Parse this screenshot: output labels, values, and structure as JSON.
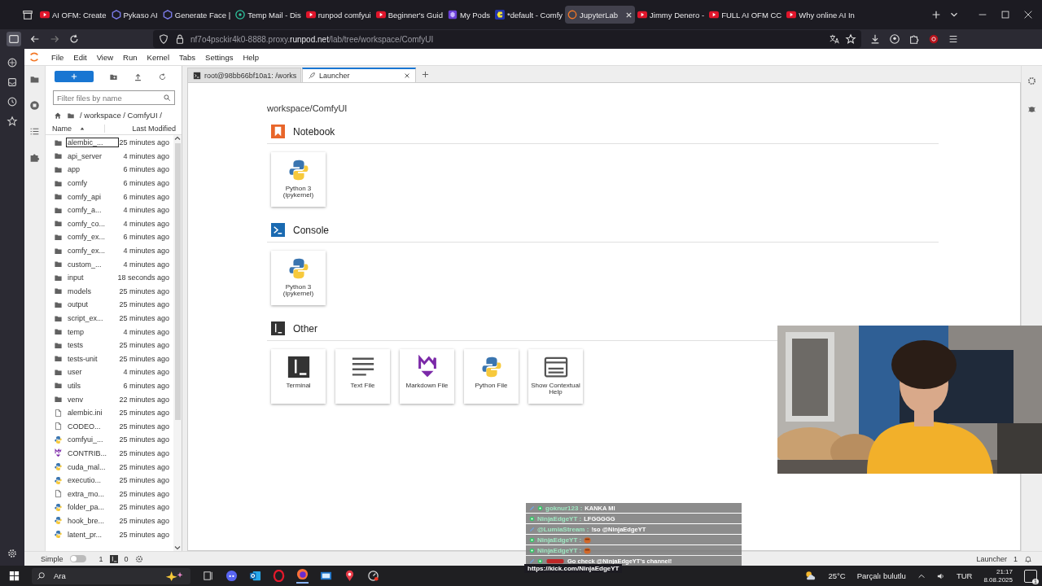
{
  "browser": {
    "tabs": [
      {
        "title": "AI OFM: Create",
        "kind": "youtube",
        "selected": false
      },
      {
        "title": "Pykaso AI",
        "kind": "hex",
        "selected": false
      },
      {
        "title": "Generate Face |",
        "kind": "hex",
        "selected": false
      },
      {
        "title": "Temp Mail - Dis",
        "kind": "mail",
        "selected": false
      },
      {
        "title": "runpod comfyui",
        "kind": "youtube",
        "selected": false
      },
      {
        "title": "Beginner's Guid",
        "kind": "youtube",
        "selected": false
      },
      {
        "title": "My Pods",
        "kind": "pods",
        "selected": false
      },
      {
        "title": "*default - Comfy",
        "kind": "comfy",
        "selected": false
      },
      {
        "title": "JupyterLab",
        "kind": "jupyter",
        "selected": true
      },
      {
        "title": "Jimmy Denero -",
        "kind": "youtube",
        "selected": false
      },
      {
        "title": "FULL AI OFM CC",
        "kind": "youtube",
        "selected": false
      },
      {
        "title": "Why online AI In",
        "kind": "youtube",
        "selected": false
      }
    ],
    "url": {
      "host": "nf7o4psckir4k0-8888.proxy.",
      "domain": "runpod.net",
      "path": "/lab/tree/workspace/ComfyUI"
    }
  },
  "menu": [
    "File",
    "Edit",
    "View",
    "Run",
    "Kernel",
    "Tabs",
    "Settings",
    "Help"
  ],
  "file_browser": {
    "filter": {
      "placeholder": "Filter files by name"
    },
    "breadcrumb": "/ workspace / ComfyUI /",
    "columns": [
      "Name",
      "Last Modified"
    ],
    "rows": [
      {
        "name": "alembic_...",
        "modified": "25 minutes ago",
        "kind": "folder",
        "selected": true
      },
      {
        "name": "api_server",
        "modified": "4 minutes ago",
        "kind": "folder",
        "selected": false
      },
      {
        "name": "app",
        "modified": "6 minutes ago",
        "kind": "folder",
        "selected": false
      },
      {
        "name": "comfy",
        "modified": "6 minutes ago",
        "kind": "folder",
        "selected": false
      },
      {
        "name": "comfy_api",
        "modified": "6 minutes ago",
        "kind": "folder",
        "selected": false
      },
      {
        "name": "comfy_a...",
        "modified": "4 minutes ago",
        "kind": "folder",
        "selected": false
      },
      {
        "name": "comfy_co...",
        "modified": "4 minutes ago",
        "kind": "folder",
        "selected": false
      },
      {
        "name": "comfy_ex...",
        "modified": "6 minutes ago",
        "kind": "folder",
        "selected": false
      },
      {
        "name": "comfy_ex...",
        "modified": "4 minutes ago",
        "kind": "folder",
        "selected": false
      },
      {
        "name": "custom_...",
        "modified": "4 minutes ago",
        "kind": "folder",
        "selected": false
      },
      {
        "name": "input",
        "modified": "18 seconds ago",
        "kind": "folder",
        "selected": false
      },
      {
        "name": "models",
        "modified": "25 minutes ago",
        "kind": "folder",
        "selected": false
      },
      {
        "name": "output",
        "modified": "25 minutes ago",
        "kind": "folder",
        "selected": false
      },
      {
        "name": "script_ex...",
        "modified": "25 minutes ago",
        "kind": "folder",
        "selected": false
      },
      {
        "name": "temp",
        "modified": "4 minutes ago",
        "kind": "folder",
        "selected": false
      },
      {
        "name": "tests",
        "modified": "25 minutes ago",
        "kind": "folder",
        "selected": false
      },
      {
        "name": "tests-unit",
        "modified": "25 minutes ago",
        "kind": "folder",
        "selected": false
      },
      {
        "name": "user",
        "modified": "4 minutes ago",
        "kind": "folder",
        "selected": false
      },
      {
        "name": "utils",
        "modified": "6 minutes ago",
        "kind": "folder",
        "selected": false
      },
      {
        "name": "venv",
        "modified": "22 minutes ago",
        "kind": "folder",
        "selected": false
      },
      {
        "name": "alembic.ini",
        "modified": "25 minutes ago",
        "kind": "file",
        "selected": false
      },
      {
        "name": "CODEO...",
        "modified": "25 minutes ago",
        "kind": "file",
        "selected": false
      },
      {
        "name": "comfyui_...",
        "modified": "25 minutes ago",
        "kind": "python",
        "selected": false
      },
      {
        "name": "CONTRIB...",
        "modified": "25 minutes ago",
        "kind": "markdown",
        "selected": false
      },
      {
        "name": "cuda_mal...",
        "modified": "25 minutes ago",
        "kind": "python",
        "selected": false
      },
      {
        "name": "executio...",
        "modified": "25 minutes ago",
        "kind": "python",
        "selected": false
      },
      {
        "name": "extra_mo...",
        "modified": "25 minutes ago",
        "kind": "file",
        "selected": false
      },
      {
        "name": "folder_pa...",
        "modified": "25 minutes ago",
        "kind": "python",
        "selected": false
      },
      {
        "name": "hook_bre...",
        "modified": "25 minutes ago",
        "kind": "python",
        "selected": false
      },
      {
        "name": "latent_pr...",
        "modified": "25 minutes ago",
        "kind": "python",
        "selected": false
      }
    ]
  },
  "dock_tabs": [
    {
      "title": "root@98bb66bf10a1: /works",
      "kind": "terminal",
      "selected": false
    },
    {
      "title": "Launcher",
      "kind": "launcher",
      "selected": true
    }
  ],
  "launcher": {
    "path": "workspace/ComfyUI",
    "sections": [
      {
        "title": "Notebook",
        "kind": "notebook",
        "cards": [
          {
            "label": "Python 3 (ipykernel)",
            "kind": "python"
          }
        ]
      },
      {
        "title": "Console",
        "kind": "console",
        "cards": [
          {
            "label": "Python 3 (ipykernel)",
            "kind": "python"
          }
        ]
      },
      {
        "title": "Other",
        "kind": "other",
        "cards": [
          {
            "label": "Terminal",
            "kind": "terminal"
          },
          {
            "label": "Text File",
            "kind": "text"
          },
          {
            "label": "Markdown File",
            "kind": "markdown"
          },
          {
            "label": "Python File",
            "kind": "python"
          },
          {
            "label": "Show Contextual Help",
            "kind": "help"
          }
        ]
      }
    ]
  },
  "status_bar": {
    "mode": "Simple",
    "simple_on": false,
    "terminals": "1",
    "kernels": "0",
    "current": "Launcher",
    "count": "1"
  },
  "chat": [
    {
      "kind": "both",
      "user": "goknur123 :",
      "text": "KANKA MI"
    },
    {
      "kind": "dot",
      "user": "NinjaEdgeYT :",
      "text": "LFGGGGG"
    },
    {
      "kind": "pencil",
      "user": "@LumiaStream :",
      "text": "!so @NinjaEdgeYT"
    },
    {
      "kind": "dot",
      "user": "NinjaEdgeYT :",
      "emote": true
    },
    {
      "kind": "dot",
      "user": "NinjaEdgeYT :",
      "emote": true
    },
    {
      "kind": "both",
      "text": "Go check @NinjaEdgeYT's channel!"
    }
  ],
  "link_preview": "https://kick.com/NinjaEdgeYT",
  "taskbar": {
    "search": "Ara",
    "weather": "25°C",
    "forecast": "Parçalı bulutlu",
    "language": "TUR",
    "time": "21:17",
    "date": "8.08.2025",
    "notifications": "1"
  }
}
